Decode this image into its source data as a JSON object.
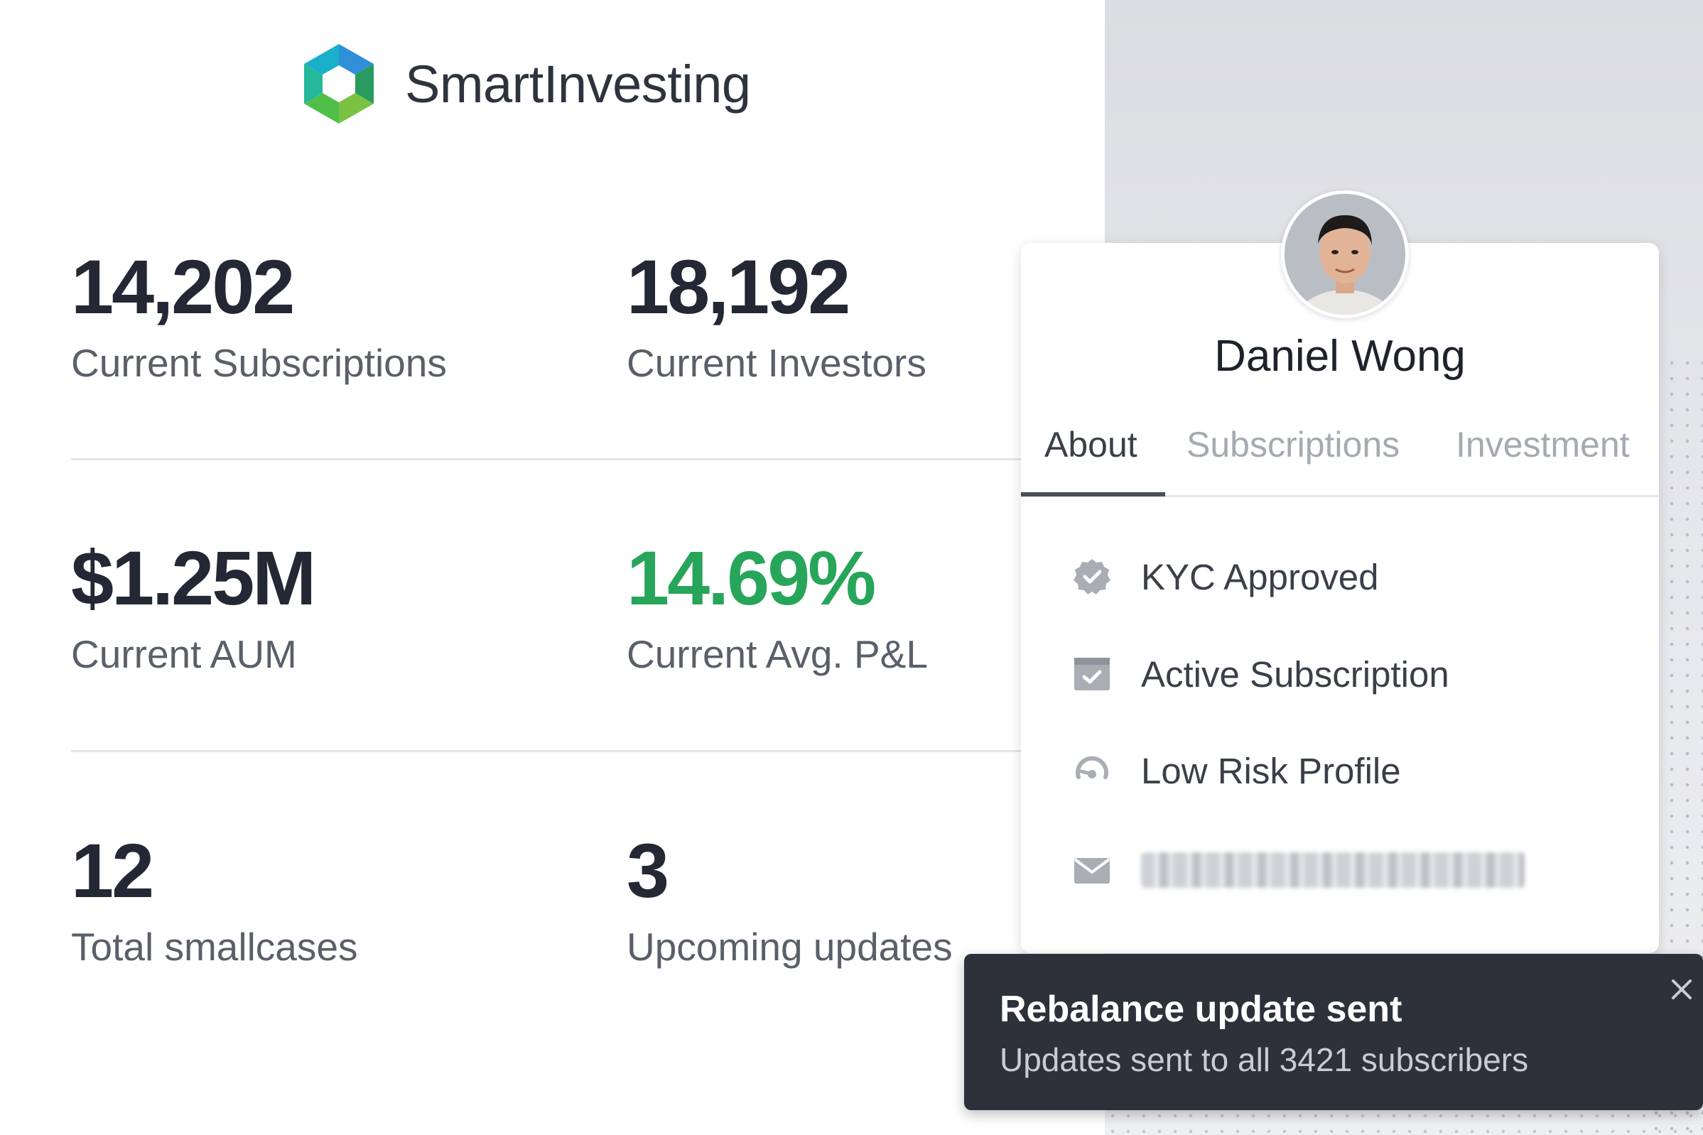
{
  "brand": {
    "name": "SmartInvesting",
    "logo_icon": "hexagon-logo-icon"
  },
  "stats": [
    {
      "value": "14,202",
      "label": "Current Subscriptions"
    },
    {
      "value": "18,192",
      "label": "Current Investors"
    },
    {
      "value": "$1.25M",
      "label": "Current AUM"
    },
    {
      "value": "14.69%",
      "label": "Current Avg. P&L",
      "color": "#27a55a"
    },
    {
      "value": "12",
      "label": "Total smallcases"
    },
    {
      "value": "3",
      "label": "Upcoming updates"
    }
  ],
  "profile": {
    "name": "Daniel Wong",
    "tabs": [
      {
        "label": "About",
        "active": true
      },
      {
        "label": "Subscriptions",
        "active": false
      },
      {
        "label": "Investment",
        "active": false
      }
    ],
    "details": [
      {
        "icon": "verified-badge-icon",
        "text": "KYC Approved"
      },
      {
        "icon": "calendar-check-icon",
        "text": "Active Subscription"
      },
      {
        "icon": "risk-gauge-icon",
        "text": "Low Risk Profile"
      },
      {
        "icon": "mail-icon",
        "text": ""
      }
    ]
  },
  "toast": {
    "title": "Rebalance update sent",
    "message": "Updates sent to all 3421 subscribers",
    "close_icon": "close-icon"
  },
  "colors": {
    "accent_green": "#27a55a",
    "toast_bg": "#2c313a",
    "text_dark": "#232834"
  }
}
